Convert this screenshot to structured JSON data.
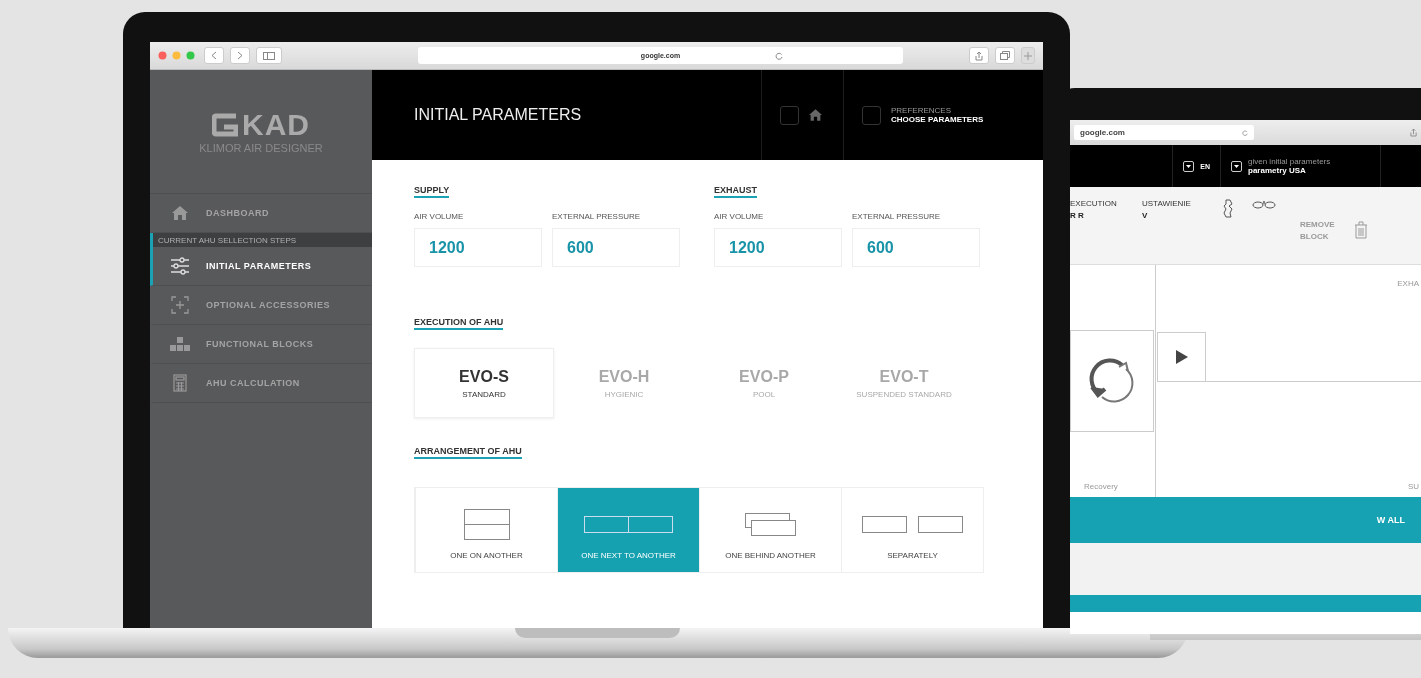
{
  "browser": {
    "url": "google.com"
  },
  "sidebar": {
    "logo": {
      "text": "KAD",
      "subtitle": "KLIMOR AIR DESIGNER"
    },
    "dashboard": {
      "label": "DASHBOARD",
      "selected": false
    },
    "section_label": "CURRENT AHU  SELLECTION STEPS",
    "steps": [
      {
        "label": "INITIAL PARAMETERS",
        "selected": true
      },
      {
        "label": "OPTIONAL ACCESSORIES",
        "selected": false
      },
      {
        "label": "FUNCTIONAL BLOCKS",
        "selected": false
      },
      {
        "label": "AHU CALCULATION",
        "selected": false
      }
    ]
  },
  "header": {
    "title": "INITIAL PARAMETERS",
    "preferences": {
      "caption": "PREFERENCES",
      "value": "CHOOSE PARAMETERS"
    }
  },
  "groups": [
    {
      "title": "SUPPLY",
      "fields": [
        {
          "label": "AIR VOLUME",
          "value": "1200"
        },
        {
          "label": "EXTERNAL PRESSURE",
          "value": "600"
        }
      ]
    },
    {
      "title": "EXHAUST",
      "fields": [
        {
          "label": "AIR VOLUME",
          "value": "1200"
        },
        {
          "label": "EXTERNAL PRESSURE",
          "value": "600"
        }
      ]
    }
  ],
  "execution": {
    "title": "EXECUTION OF AHU",
    "options": [
      {
        "name": "EVO-S",
        "subtitle": "STANDARD",
        "selected": true
      },
      {
        "name": "EVO-H",
        "subtitle": "HYGIENIC",
        "selected": false
      },
      {
        "name": "EVO-P",
        "subtitle": "POOL",
        "selected": false
      },
      {
        "name": "EVO-T",
        "subtitle": "SUSPENDED STANDARD",
        "selected": false
      }
    ]
  },
  "arrangement": {
    "title": "ARRANGEMENT OF AHU",
    "options": [
      {
        "label": "ONE ON ANOTHER",
        "selected": false
      },
      {
        "label": "ONE NEXT TO ANOTHER",
        "selected": true
      },
      {
        "label": "ONE BEHIND ANOTHER",
        "selected": false
      },
      {
        "label": "SEPARATELY",
        "selected": false
      }
    ]
  },
  "second_screen": {
    "url": "google.com",
    "language": "EN",
    "preset": {
      "caption": "given initial parameters",
      "value": "parametry USA"
    },
    "fields": [
      {
        "label": "EXECUTION",
        "value": "R R"
      },
      {
        "label": "USTAWIENIE",
        "value": "V"
      }
    ],
    "remove_label": "REMOVE BLOCK",
    "exhaust_label": "EXHA",
    "block_label": "Recovery",
    "supply_label": "SU",
    "show_all_label": "W ALL"
  }
}
